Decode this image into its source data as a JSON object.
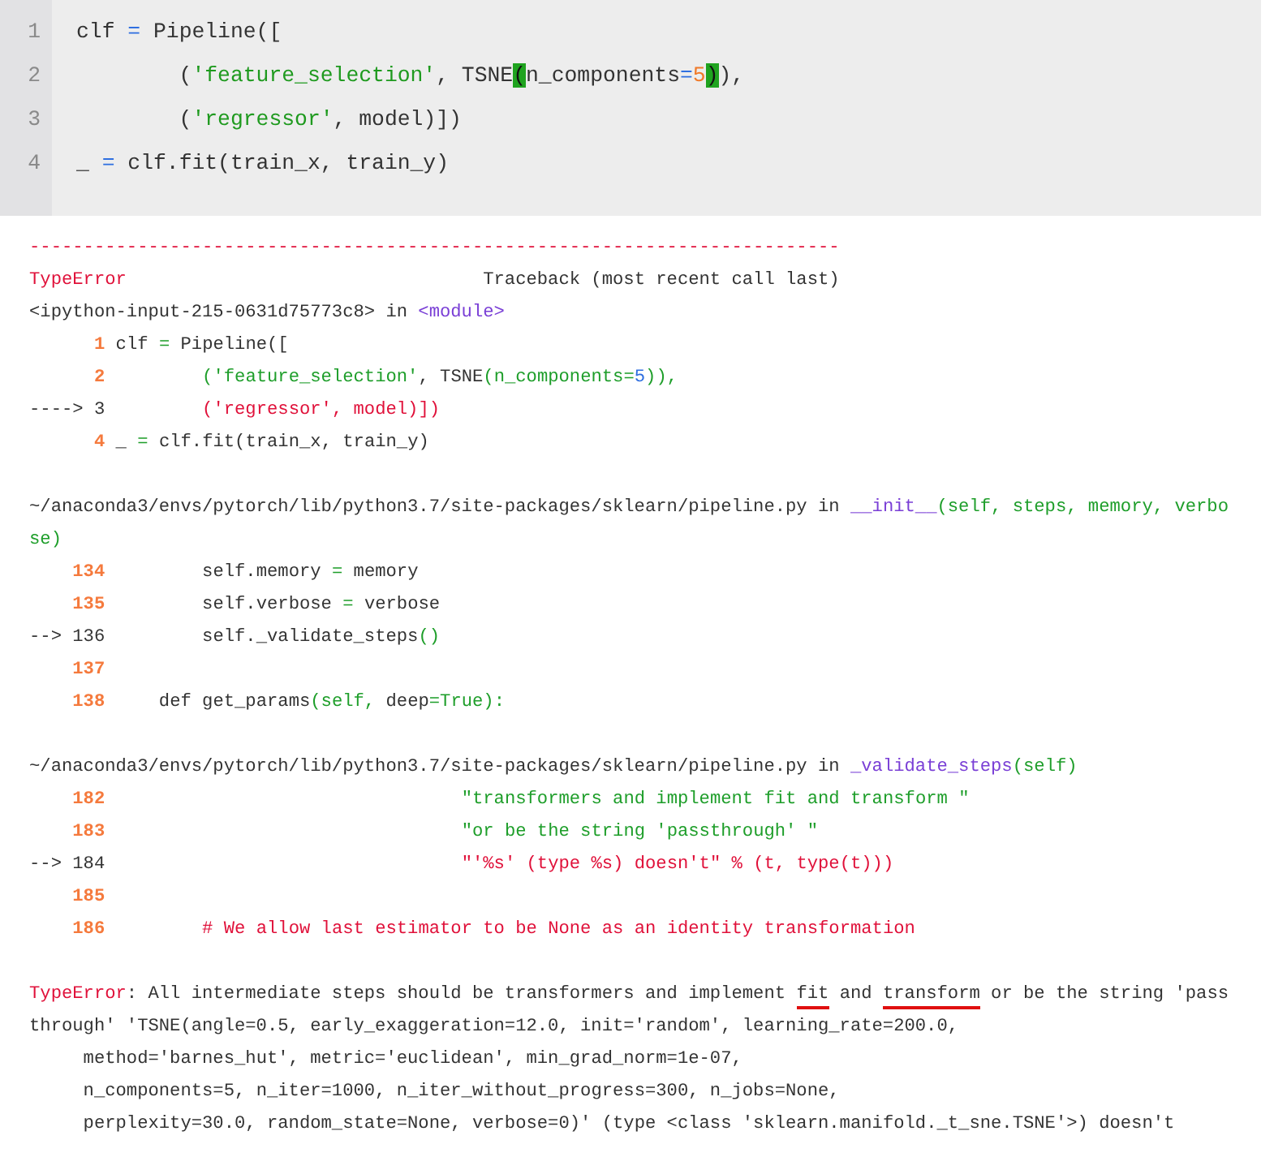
{
  "editor": {
    "lines": [
      {
        "number": "1",
        "segments": [
          {
            "text": "clf ",
            "kind": "plain"
          },
          {
            "text": "=",
            "kind": "op"
          },
          {
            "text": " Pipeline([",
            "kind": "plain"
          }
        ]
      },
      {
        "number": "2",
        "segments": [
          {
            "text": "        (",
            "kind": "plain"
          },
          {
            "text": "'feature_selection'",
            "kind": "str"
          },
          {
            "text": ", TSNE",
            "kind": "plain"
          },
          {
            "text": "(",
            "kind": "match"
          },
          {
            "text": "n_components",
            "kind": "plain"
          },
          {
            "text": "=",
            "kind": "op"
          },
          {
            "text": "5",
            "kind": "num"
          },
          {
            "text": ")",
            "kind": "match"
          },
          {
            "text": "),",
            "kind": "plain"
          }
        ]
      },
      {
        "number": "3",
        "segments": [
          {
            "text": "        (",
            "kind": "plain"
          },
          {
            "text": "'regressor'",
            "kind": "str"
          },
          {
            "text": ", model)])",
            "kind": "plain"
          }
        ]
      },
      {
        "number": "4",
        "segments": [
          {
            "text": "_ ",
            "kind": "plain"
          },
          {
            "text": "=",
            "kind": "op"
          },
          {
            "text": " clf.fit(train_x, train_y)",
            "kind": "plain"
          }
        ]
      }
    ]
  },
  "output": {
    "lines": [
      {
        "kind": "text",
        "segments": [
          {
            "text": "---------------------------------------------------------------------------",
            "kind": "err"
          }
        ]
      },
      {
        "kind": "text",
        "segments": [
          {
            "text": "TypeError",
            "kind": "err"
          },
          {
            "text": "                                 Traceback (most recent call last)",
            "kind": "plain"
          }
        ]
      },
      {
        "kind": "text",
        "segments": [
          {
            "text": "<ipython-input-215-0631d75773c8> in ",
            "kind": "plain"
          },
          {
            "text": "<module>",
            "kind": "name"
          }
        ]
      },
      {
        "kind": "frame",
        "number": "1",
        "current": false,
        "segments": [
          {
            "text": "clf ",
            "kind": "plain"
          },
          {
            "text": "=",
            "kind": "op"
          },
          {
            "text": " Pipeline([",
            "kind": "plain"
          }
        ]
      },
      {
        "kind": "frame",
        "number": "2",
        "current": false,
        "segments": [
          {
            "text": "        (",
            "kind": "op"
          },
          {
            "text": "'feature_selection'",
            "kind": "str"
          },
          {
            "text": ", TSNE",
            "kind": "plain"
          },
          {
            "text": "(n_components=",
            "kind": "op"
          },
          {
            "text": "5",
            "kind": "num"
          },
          {
            "text": ")),",
            "kind": "op"
          }
        ]
      },
      {
        "kind": "frame",
        "marker": "---->",
        "number": "3",
        "current": true,
        "segments": [
          {
            "text": "        ('regressor', model)])",
            "kind": "err"
          }
        ]
      },
      {
        "kind": "frame",
        "number": "4",
        "current": false,
        "segments": [
          {
            "text": "_ ",
            "kind": "plain"
          },
          {
            "text": "=",
            "kind": "op"
          },
          {
            "text": " clf.fit(train_x, train_y)",
            "kind": "plain"
          }
        ]
      },
      {
        "kind": "blank"
      },
      {
        "kind": "text",
        "segments": [
          {
            "text": "~/anaconda3/envs/pytorch/lib/python3.7/site-packages/sklearn/pipeline.py in ",
            "kind": "plain"
          },
          {
            "text": "__init__",
            "kind": "name"
          },
          {
            "text": "(self, steps, memory, verbose)",
            "kind": "op"
          }
        ]
      },
      {
        "kind": "frame",
        "number": "134",
        "current": false,
        "segments": [
          {
            "text": "        self.memory ",
            "kind": "plain"
          },
          {
            "text": "=",
            "kind": "op"
          },
          {
            "text": " memory",
            "kind": "plain"
          }
        ]
      },
      {
        "kind": "frame",
        "number": "135",
        "current": false,
        "segments": [
          {
            "text": "        self.verbose ",
            "kind": "plain"
          },
          {
            "text": "=",
            "kind": "op"
          },
          {
            "text": " verbose",
            "kind": "plain"
          }
        ]
      },
      {
        "kind": "frame",
        "marker": "-->",
        "number": "136",
        "current": true,
        "segments": [
          {
            "text": "        self._validate_steps",
            "kind": "plain"
          },
          {
            "text": "()",
            "kind": "op"
          }
        ]
      },
      {
        "kind": "frame",
        "number": "137",
        "current": false
      },
      {
        "kind": "frame",
        "number": "138",
        "current": false,
        "segments": [
          {
            "text": "    def get_params",
            "kind": "plain"
          },
          {
            "text": "(self, ",
            "kind": "op"
          },
          {
            "text": "deep",
            "kind": "plain"
          },
          {
            "text": "=True):",
            "kind": "op"
          }
        ]
      },
      {
        "kind": "blank"
      },
      {
        "kind": "text",
        "segments": [
          {
            "text": "~/anaconda3/envs/pytorch/lib/python3.7/site-packages/sklearn/pipeline.py in ",
            "kind": "plain"
          },
          {
            "text": "_validate_steps",
            "kind": "name"
          },
          {
            "text": "(self)",
            "kind": "op"
          }
        ]
      },
      {
        "kind": "frame",
        "number": "182",
        "current": false,
        "segments": [
          {
            "text": "                                \"transformers and implement fit and transform \"",
            "kind": "str"
          }
        ]
      },
      {
        "kind": "frame",
        "number": "183",
        "current": false,
        "segments": [
          {
            "text": "                                \"or be the string 'passthrough' \"",
            "kind": "str"
          }
        ]
      },
      {
        "kind": "frame",
        "marker": "-->",
        "number": "184",
        "current": true,
        "segments": [
          {
            "text": "                                \"'%s' (type %s) doesn't\" % (t, type(t)))",
            "kind": "err"
          }
        ]
      },
      {
        "kind": "frame",
        "number": "185",
        "current": false
      },
      {
        "kind": "frame",
        "number": "186",
        "current": false,
        "segments": [
          {
            "text": "        # We allow last estimator to be None as an identity transformation",
            "kind": "err"
          }
        ]
      },
      {
        "kind": "blank"
      },
      {
        "kind": "text",
        "segments": [
          {
            "text": "TypeError",
            "kind": "err"
          },
          {
            "text": ": All intermediate steps should be transformers and implement ",
            "kind": "plain"
          },
          {
            "text": "fit",
            "kind": "underlined"
          },
          {
            "text": " and ",
            "kind": "plain"
          },
          {
            "text": "transform",
            "kind": "underlined"
          },
          {
            "text": " or be the string 'passthrough' 'TSNE(angle=0.5, early_exaggeration=12.0, init='random', learning_rate=200.0,",
            "kind": "plain"
          }
        ]
      },
      {
        "kind": "text",
        "segments": [
          {
            "text": "     method='barnes_hut', metric='euclidean', min_grad_norm=1e-07,",
            "kind": "plain"
          }
        ]
      },
      {
        "kind": "text",
        "segments": [
          {
            "text": "     n_components=5, n_iter=1000, n_iter_without_progress=300, n_jobs=None,",
            "kind": "plain"
          }
        ]
      },
      {
        "kind": "text",
        "segments": [
          {
            "text": "     perplexity=30.0, random_state=None, verbose=0)' (type <class 'sklearn.manifold._t_sne.TSNE'>) doesn't",
            "kind": "plain"
          }
        ]
      }
    ]
  }
}
